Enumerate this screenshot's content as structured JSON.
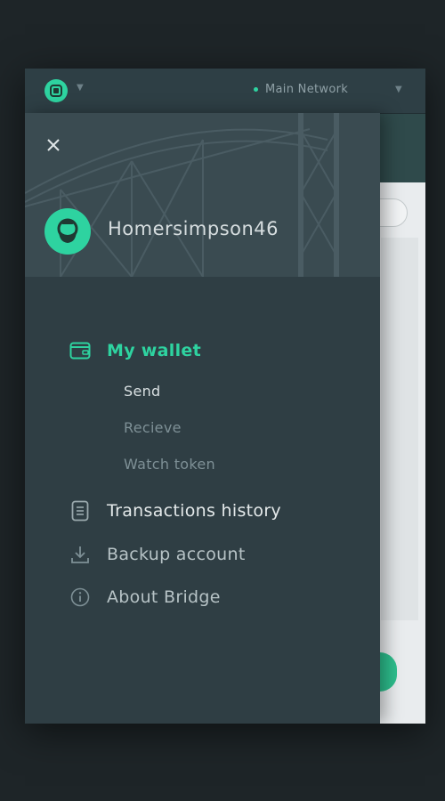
{
  "topbar": {
    "network_label": "Main Network"
  },
  "drawer": {
    "username": "Homersimpson46",
    "menu": {
      "wallet": "My wallet",
      "send": "Send",
      "receive": "Recieve",
      "watch_token": "Watch token",
      "transactions": "Transactions history",
      "backup": "Backup account",
      "about": "About Bridge"
    }
  },
  "colors": {
    "accent": "#2ed3a0",
    "drawer_bg": "#2f3e44",
    "header_bg": "#3a4b51"
  },
  "icons": {
    "close": "close-icon",
    "wallet": "wallet-icon",
    "transactions": "document-icon",
    "backup": "download-icon",
    "about": "info-icon"
  }
}
